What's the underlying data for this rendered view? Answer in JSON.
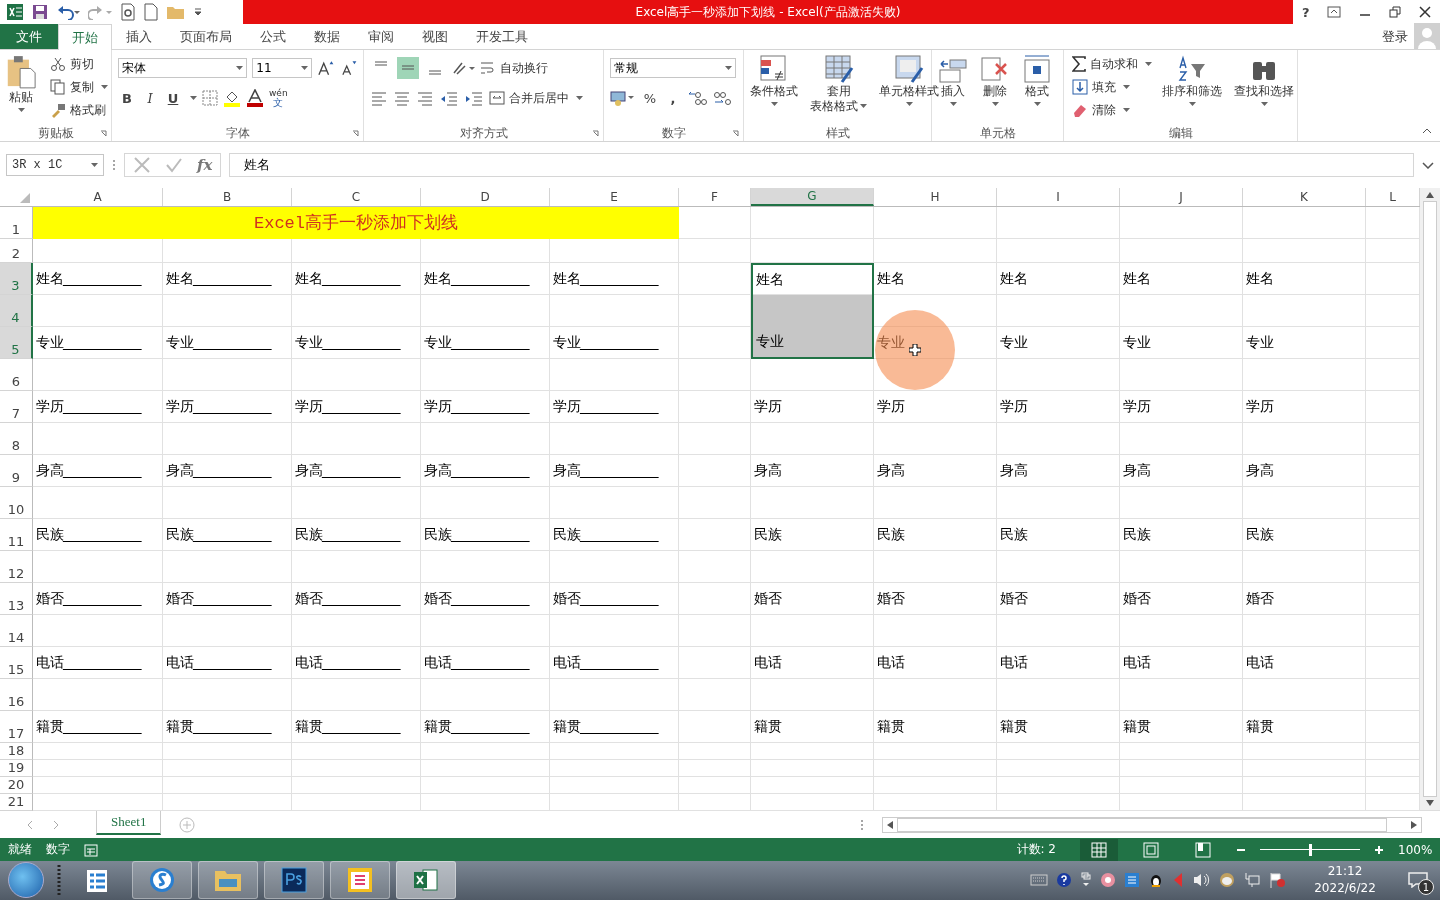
{
  "window": {
    "title": "Excel高手一秒添加下划线 - Excel(产品激活失败)",
    "help": "?"
  },
  "menu_tabs": [
    {
      "label": "文件",
      "kind": "file",
      "selected": false
    },
    {
      "label": "开始",
      "kind": "tab",
      "selected": true
    },
    {
      "label": "插入",
      "kind": "tab",
      "selected": false
    },
    {
      "label": "页面布局",
      "kind": "tab",
      "selected": false
    },
    {
      "label": "公式",
      "kind": "tab",
      "selected": false
    },
    {
      "label": "数据",
      "kind": "tab",
      "selected": false
    },
    {
      "label": "审阅",
      "kind": "tab",
      "selected": false
    },
    {
      "label": "视图",
      "kind": "tab",
      "selected": false
    },
    {
      "label": "开发工具",
      "kind": "tab",
      "selected": false
    }
  ],
  "account": {
    "label": "登录"
  },
  "ribbon": {
    "clipboard": {
      "label": "剪贴板",
      "paste": "粘贴",
      "cut": "剪切",
      "copy": "复制",
      "format_painter": "格式刷"
    },
    "font": {
      "label": "字体",
      "font_name": "宋体",
      "font_size": "11",
      "bold": "B",
      "italic": "I",
      "underline": "U",
      "phonetic_top": "wén",
      "phonetic_bottom": "文"
    },
    "alignment": {
      "label": "对齐方式",
      "vertical_align": [
        {
          "selected": false
        },
        {
          "selected": true
        },
        {
          "selected": false
        }
      ],
      "wrap_text": "自动换行",
      "merge_center": "合并后居中"
    },
    "number": {
      "label": "数字",
      "format": "常规",
      "percent": "%",
      "comma": ","
    },
    "styles": {
      "label": "样式",
      "conditional": "条件格式",
      "table_format_1": "套用",
      "table_format_2": "表格格式",
      "cell_styles": "单元格样式"
    },
    "cells": {
      "label": "单元格",
      "insert": "插入",
      "delete": "删除",
      "format": "格式"
    },
    "editing": {
      "label": "编辑",
      "autosum": "自动求和",
      "fill": "填充",
      "clear": "清除",
      "sort_filter": "排序和筛选",
      "find_select": "查找和选择"
    }
  },
  "formula_bar": {
    "name_box": "3R x 1C",
    "function_label": "fx",
    "content": "姓名"
  },
  "sheet": {
    "columns": [
      {
        "label": "A",
        "selected": false
      },
      {
        "label": "B",
        "selected": false
      },
      {
        "label": "C",
        "selected": false
      },
      {
        "label": "D",
        "selected": false
      },
      {
        "label": "E",
        "selected": false
      },
      {
        "label": "F",
        "selected": false
      },
      {
        "label": "G",
        "selected": true
      },
      {
        "label": "H",
        "selected": false
      },
      {
        "label": "I",
        "selected": false
      },
      {
        "label": "J",
        "selected": false
      },
      {
        "label": "K",
        "selected": false
      },
      {
        "label": "L",
        "selected": false
      }
    ],
    "rows": [
      {
        "number": "1",
        "selected": false,
        "banner": "Excel高手一秒添加下划线"
      },
      {
        "number": "2",
        "selected": false
      },
      {
        "number": "3",
        "selected": true,
        "left": [
          "姓名____________",
          "姓名____________",
          "姓名____________",
          "姓名____________",
          "姓名____________"
        ],
        "right": [
          "姓名",
          "姓名",
          "姓名",
          "姓名",
          "姓名"
        ]
      },
      {
        "number": "4",
        "selected": true
      },
      {
        "number": "5",
        "selected": true,
        "left": [
          "专业____________",
          "专业____________",
          "专业____________",
          "专业____________",
          "专业____________"
        ],
        "right": [
          "专业",
          "专业",
          "专业",
          "专业",
          "专业"
        ]
      },
      {
        "number": "6",
        "selected": false
      },
      {
        "number": "7",
        "selected": false,
        "left": [
          "学历____________",
          "学历____________",
          "学历____________",
          "学历____________",
          "学历____________"
        ],
        "right": [
          "学历",
          "学历",
          "学历",
          "学历",
          "学历"
        ]
      },
      {
        "number": "8",
        "selected": false
      },
      {
        "number": "9",
        "selected": false,
        "left": [
          "身高____________",
          "身高____________",
          "身高____________",
          "身高____________",
          "身高____________"
        ],
        "right": [
          "身高",
          "身高",
          "身高",
          "身高",
          "身高"
        ]
      },
      {
        "number": "10",
        "selected": false
      },
      {
        "number": "11",
        "selected": false,
        "left": [
          "民族____________",
          "民族____________",
          "民族____________",
          "民族____________",
          "民族____________"
        ],
        "right": [
          "民族",
          "民族",
          "民族",
          "民族",
          "民族"
        ]
      },
      {
        "number": "12",
        "selected": false
      },
      {
        "number": "13",
        "selected": false,
        "left": [
          "婚否____________",
          "婚否____________",
          "婚否____________",
          "婚否____________",
          "婚否____________"
        ],
        "right": [
          "婚否",
          "婚否",
          "婚否",
          "婚否",
          "婚否"
        ]
      },
      {
        "number": "14",
        "selected": false
      },
      {
        "number": "15",
        "selected": false,
        "left": [
          "电话____________",
          "电话____________",
          "电话____________",
          "电话____________",
          "电话____________"
        ],
        "right": [
          "电话",
          "电话",
          "电话",
          "电话",
          "电话"
        ]
      },
      {
        "number": "16",
        "selected": false
      },
      {
        "number": "17",
        "selected": false,
        "left": [
          "籍贯____________",
          "籍贯____________",
          "籍贯____________",
          "籍贯____________",
          "籍贯____________"
        ],
        "right": [
          "籍贯",
          "籍贯",
          "籍贯",
          "籍贯",
          "籍贯"
        ]
      },
      {
        "number": "18",
        "selected": false
      },
      {
        "number": "19",
        "selected": false
      },
      {
        "number": "20",
        "selected": false
      },
      {
        "number": "21",
        "selected": false
      }
    ]
  },
  "sheet_tabs": [
    {
      "label": "Sheet1",
      "selected": true
    }
  ],
  "status_bar": {
    "mode": "就绪",
    "numlock": "数字",
    "count": "计数: 2",
    "zoom": "100%",
    "zoom_slider": {
      "level": 0.5
    }
  },
  "taskbar": {
    "time": "21:12",
    "date": "2022/6/22",
    "notifications": "1"
  }
}
